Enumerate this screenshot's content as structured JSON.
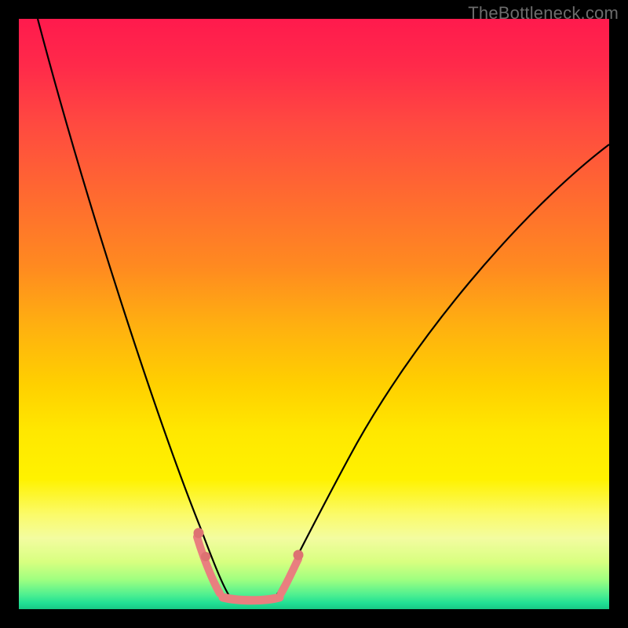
{
  "watermark": "TheBottleneck.com",
  "colors": {
    "frame": "#000000",
    "curve": "#000000",
    "accent_line": "#e97f7f",
    "accent_dot": "#d86d6d"
  },
  "chart_data": {
    "type": "line",
    "title": "",
    "xlabel": "",
    "ylabel": "",
    "xlim": [
      0,
      100
    ],
    "ylim": [
      0,
      100
    ],
    "grid": false,
    "legend": false,
    "series": [
      {
        "name": "left-branch",
        "x": [
          3,
          6,
          10,
          14,
          18,
          22,
          26,
          28,
          30,
          31.5,
          33,
          34,
          35
        ],
        "y": [
          100,
          90,
          78,
          65,
          52,
          39,
          25,
          18,
          11,
          7,
          4,
          2.5,
          2
        ]
      },
      {
        "name": "valley-floor",
        "x": [
          35,
          37,
          39,
          41,
          43
        ],
        "y": [
          2,
          1.8,
          1.8,
          1.8,
          2
        ]
      },
      {
        "name": "right-branch",
        "x": [
          43,
          45,
          48,
          52,
          58,
          66,
          76,
          88,
          100
        ],
        "y": [
          2,
          3,
          6,
          11,
          19,
          30,
          44,
          59,
          73
        ]
      }
    ],
    "accent_segments": [
      {
        "name": "left-marker",
        "x": [
          30,
          33.5
        ],
        "y": [
          11,
          3.5
        ]
      },
      {
        "name": "right-marker",
        "x": [
          44.5,
          47
        ],
        "y": [
          3,
          8
        ]
      },
      {
        "name": "floor-marker",
        "x": [
          34.5,
          43.5
        ],
        "y": [
          2,
          2
        ]
      }
    ],
    "accent_dots": [
      {
        "x": 30.3,
        "y": 10.8
      },
      {
        "x": 31.5,
        "y": 7.0
      },
      {
        "x": 47.0,
        "y": 8.0
      }
    ]
  }
}
